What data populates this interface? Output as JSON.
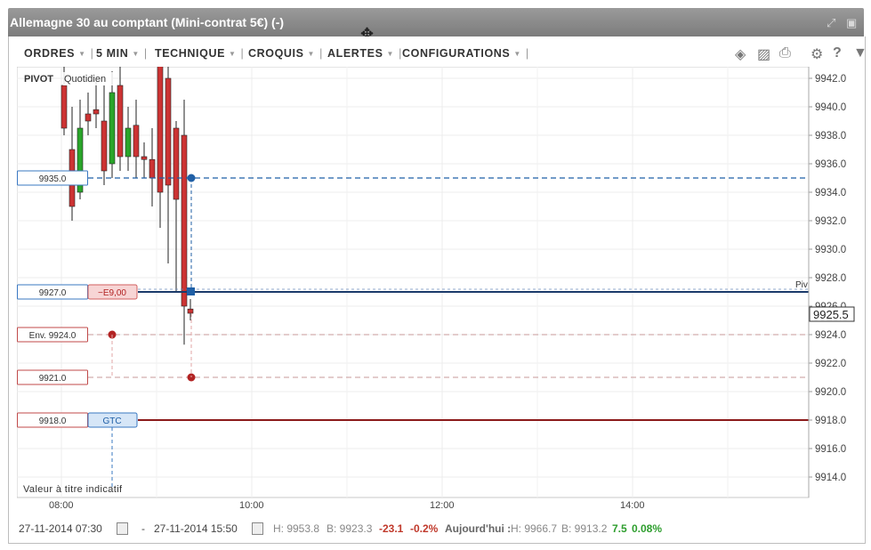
{
  "window": {
    "title": "Allemagne 30 au comptant (Mini-contrat 5€) (-)"
  },
  "toolbar": {
    "menus": [
      "ORDRES",
      "5 MIN",
      "TECHNIQUE",
      "CROQUIS",
      "ALERTES",
      "CONFIGURATIONS"
    ],
    "icons": [
      "layers-icon",
      "image-icon",
      "print-icon",
      "gear-icon",
      "help-icon",
      "pin-icon"
    ]
  },
  "chart": {
    "pivot_label": "PIVOT",
    "pivot_period": "Quotidien",
    "pivot_line_label": "Piv",
    "note": "Valeur à titre indicatif",
    "current_price": "9925.5",
    "y_ticks": [
      "9942.0",
      "9940.0",
      "9938.0",
      "9936.0",
      "9934.0",
      "9932.0",
      "9930.0",
      "9928.0",
      "9926.0",
      "9924.0",
      "9922.0",
      "9920.0",
      "9918.0",
      "9916.0",
      "9914.0"
    ],
    "x_ticks": [
      "08:00",
      "10:00",
      "12:00",
      "14:00"
    ],
    "orders": [
      {
        "price": "9935.0",
        "tag": ""
      },
      {
        "price": "9927.0",
        "tag": "−E9,00"
      },
      {
        "price": "Env. 9924.0",
        "tag": ""
      },
      {
        "price": "9921.0",
        "tag": ""
      },
      {
        "price": "9918.0",
        "tag": "GTC"
      }
    ]
  },
  "footer": {
    "from": "27-11-2014 07:30",
    "dash": "-",
    "to": "27-11-2014 15:50",
    "high": "H: 9953.8",
    "low": "B: 9923.3",
    "change": "-23.1",
    "change_pct": "-0.2%",
    "today_label": "Aujourd'hui :",
    "today_high": "H: 9966.7",
    "today_low": "B: 9913.2",
    "today_change": "7.5",
    "today_pct": "0.08%"
  },
  "colors": {
    "up": "#2aa52a",
    "down": "#cc3333",
    "blue_line": "#1f5fa6",
    "red_line": "#8b1a1a"
  }
}
